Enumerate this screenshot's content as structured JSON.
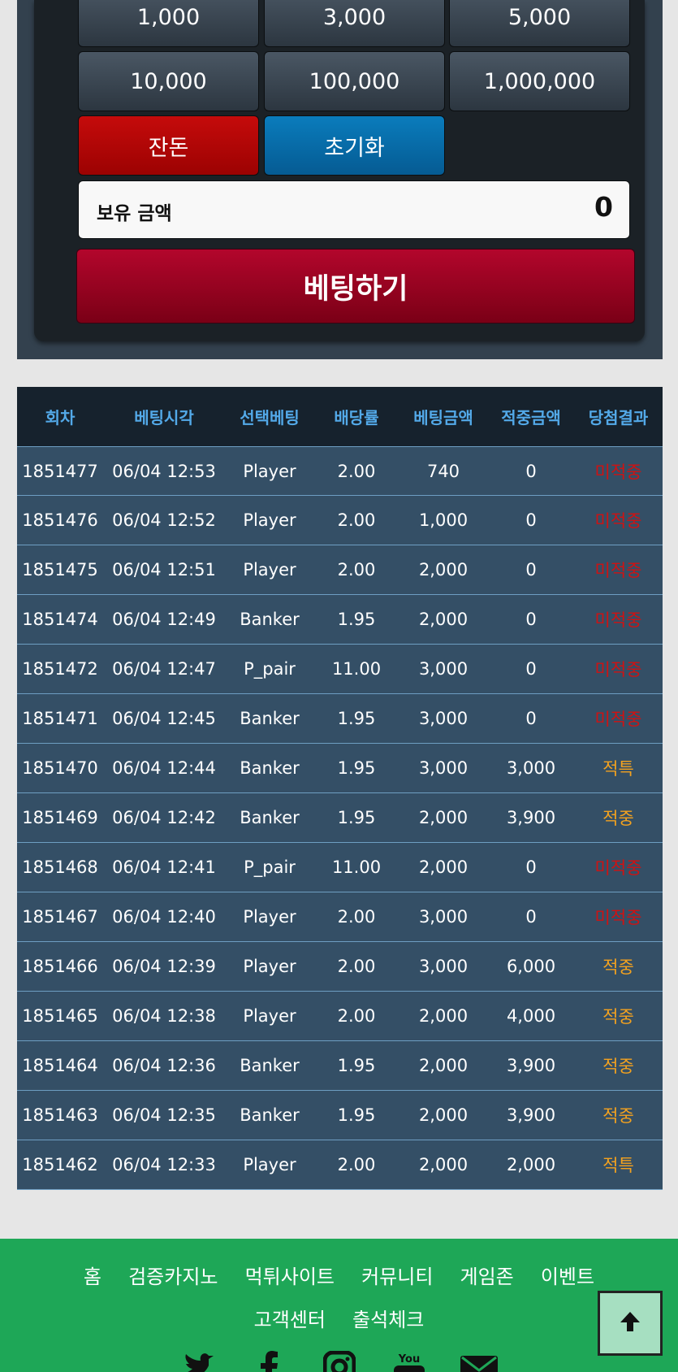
{
  "chips": [
    "1,000",
    "3,000",
    "5,000",
    "10,000",
    "100,000",
    "1,000,000"
  ],
  "actions": {
    "remaining": "잔돈",
    "reset": "초기화"
  },
  "balance": {
    "label": "보유 금액",
    "value": "0"
  },
  "bet_button": "베팅하기",
  "table": {
    "headers": [
      "회차",
      "베팅시각",
      "선택베팅",
      "배당률",
      "베팅금액",
      "적중금액",
      "당첨결과"
    ],
    "rows": [
      [
        "1851477",
        "06/04 12:53",
        "Player",
        "2.00",
        "740",
        "0",
        "미적중"
      ],
      [
        "1851476",
        "06/04 12:52",
        "Player",
        "2.00",
        "1,000",
        "0",
        "미적중"
      ],
      [
        "1851475",
        "06/04 12:51",
        "Player",
        "2.00",
        "2,000",
        "0",
        "미적중"
      ],
      [
        "1851474",
        "06/04 12:49",
        "Banker",
        "1.95",
        "2,000",
        "0",
        "미적중"
      ],
      [
        "1851472",
        "06/04 12:47",
        "P_pair",
        "11.00",
        "3,000",
        "0",
        "미적중"
      ],
      [
        "1851471",
        "06/04 12:45",
        "Banker",
        "1.95",
        "3,000",
        "0",
        "미적중"
      ],
      [
        "1851470",
        "06/04 12:44",
        "Banker",
        "1.95",
        "3,000",
        "3,000",
        "적특"
      ],
      [
        "1851469",
        "06/04 12:42",
        "Banker",
        "1.95",
        "2,000",
        "3,900",
        "적중"
      ],
      [
        "1851468",
        "06/04 12:41",
        "P_pair",
        "11.00",
        "2,000",
        "0",
        "미적중"
      ],
      [
        "1851467",
        "06/04 12:40",
        "Player",
        "2.00",
        "3,000",
        "0",
        "미적중"
      ],
      [
        "1851466",
        "06/04 12:39",
        "Player",
        "2.00",
        "3,000",
        "6,000",
        "적중"
      ],
      [
        "1851465",
        "06/04 12:38",
        "Player",
        "2.00",
        "2,000",
        "4,000",
        "적중"
      ],
      [
        "1851464",
        "06/04 12:36",
        "Banker",
        "1.95",
        "2,000",
        "3,900",
        "적중"
      ],
      [
        "1851463",
        "06/04 12:35",
        "Banker",
        "1.95",
        "2,000",
        "3,900",
        "적중"
      ],
      [
        "1851462",
        "06/04 12:33",
        "Player",
        "2.00",
        "2,000",
        "2,000",
        "적특"
      ]
    ]
  },
  "footer": {
    "nav": [
      "홈",
      "검증카지노",
      "먹튀사이트",
      "커뮤니티",
      "게임존",
      "이벤트",
      "고객센터",
      "출석체크"
    ],
    "social": [
      "twitter-icon",
      "facebook-icon",
      "instagram-icon",
      "youtube-icon",
      "mail-icon"
    ]
  },
  "colors": {
    "miss": "#d01212",
    "hit": "#f3a21f",
    "footer": "#1ea757",
    "header_text": "#53a9e8"
  }
}
